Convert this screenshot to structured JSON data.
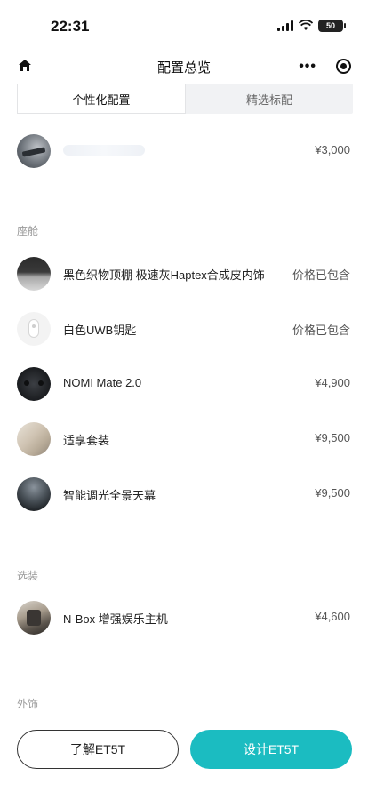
{
  "status_bar": {
    "time": "22:31",
    "battery": "50"
  },
  "header": {
    "title": "配置总览",
    "home_icon": "home-icon",
    "more_icon": "more-dots-icon",
    "target_icon": "target-icon"
  },
  "tabs": [
    {
      "label": "个性化配置",
      "active": true
    },
    {
      "label": "精选标配",
      "active": false
    }
  ],
  "top_item": {
    "name": "",
    "price": "¥3,000"
  },
  "sections": [
    {
      "label": "座舱",
      "items": [
        {
          "name": "黑色织物顶棚 极速灰Haptex合成皮内饰",
          "price": "价格已包含"
        },
        {
          "name": "白色UWB钥匙",
          "price": "价格已包含"
        },
        {
          "name": "NOMI Mate 2.0",
          "price": "¥4,900"
        },
        {
          "name": "适享套装",
          "price": "¥9,500"
        },
        {
          "name": "智能调光全景天幕",
          "price": "¥9,500"
        }
      ]
    },
    {
      "label": "选装",
      "items": [
        {
          "name": "N-Box 增强娱乐主机",
          "price": "¥4,600"
        }
      ]
    },
    {
      "label": "外饰",
      "items": []
    }
  ],
  "buttons": {
    "learn": "了解ET5T",
    "design": "设计ET5T"
  },
  "colors": {
    "accent": "#1bbcc1"
  }
}
